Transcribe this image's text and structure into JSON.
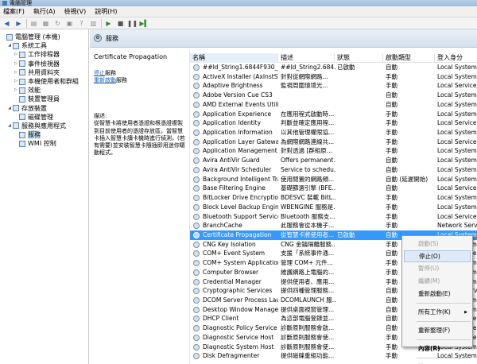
{
  "window": {
    "title": "電腦管理"
  },
  "menu": [
    "檔案(F)",
    "執行(A)",
    "檢視(V)",
    "說明(H)"
  ],
  "tree": [
    {
      "label": "電腦管理 (本機)",
      "indent": 0,
      "arrow": "",
      "icon": "computer-icon"
    },
    {
      "label": "系統工具",
      "indent": 1,
      "arrow": "◢",
      "icon": "tools-icon"
    },
    {
      "label": "工作排程器",
      "indent": 2,
      "arrow": "▷",
      "icon": "clock-icon"
    },
    {
      "label": "事件檢視器",
      "indent": 2,
      "arrow": "▷",
      "icon": "event-icon"
    },
    {
      "label": "共用資料夾",
      "indent": 2,
      "arrow": "▷",
      "icon": "folder-icon"
    },
    {
      "label": "本機使用者和群組",
      "indent": 2,
      "arrow": "▷",
      "icon": "users-icon"
    },
    {
      "label": "效能",
      "indent": 2,
      "arrow": "▷",
      "icon": "performance-icon"
    },
    {
      "label": "裝置管理員",
      "indent": 2,
      "arrow": "",
      "icon": "device-icon"
    },
    {
      "label": "存放裝置",
      "indent": 1,
      "arrow": "◢",
      "icon": "storage-icon"
    },
    {
      "label": "磁碟管理",
      "indent": 2,
      "arrow": "",
      "icon": "disk-icon"
    },
    {
      "label": "服務與應用程式",
      "indent": 1,
      "arrow": "◢",
      "icon": "apps-icon"
    },
    {
      "label": "服務",
      "indent": 2,
      "arrow": "",
      "icon": "gear-icon",
      "selected": true
    },
    {
      "label": "WMI 控制",
      "indent": 2,
      "arrow": "",
      "icon": "wmi-icon"
    }
  ],
  "header": {
    "title": "服務"
  },
  "detail": {
    "title": "Certificate Propagation",
    "stop_link": "停止",
    "stop_suffix": "服務",
    "restart_link": "重新啟動",
    "restart_suffix": "服務",
    "desc_label": "描述:",
    "desc": "從智慧卡將使用者憑證和根憑證複製到目前使用者的憑證存放區，當智慧卡插入智慧卡讀卡機時進行偵測，(若有需要)並安裝智慧卡隨插即用迷你驅動程式。"
  },
  "columns": [
    "名稱",
    "描述",
    "狀態",
    "啟動類型",
    "登入身分"
  ],
  "rows": [
    [
      "##Id_String1.6844F930_16...",
      "##Id_String2.684...",
      "已啟動",
      "自動",
      "Local System"
    ],
    [
      "ActiveX Installer (AxInstSV)",
      "針對從網際網路...",
      "",
      "手動",
      "Local System"
    ],
    [
      "Adaptive Brightness",
      "監視周圍環境光...",
      "",
      "手動",
      "Local Service"
    ],
    [
      "Adobe Version Cue CS3",
      "",
      "",
      "自動",
      "Local System"
    ],
    [
      "AMD External Events Utility",
      "",
      "",
      "自動",
      "Local System"
    ],
    [
      "Application Experience",
      "在應用程式啟動時...",
      "",
      "手動",
      "Local System"
    ],
    [
      "Application Identity",
      "判斷並確定應用程...",
      "",
      "手動",
      "Local Service"
    ],
    [
      "Application Information",
      "以其他管理權限協...",
      "",
      "手動",
      "Local System"
    ],
    [
      "Application Layer Gateway ...",
      "為網際網路連線共...",
      "",
      "手動",
      "Local Service"
    ],
    [
      "Application Management",
      "針對透過 [群組原...",
      "",
      "手動",
      "Local System"
    ],
    [
      "Avira AntiVir Guard",
      "Offers permanent...",
      "",
      "自動",
      "Local System"
    ],
    [
      "Avira AntiVir Scheduler",
      "Service to schedu...",
      "",
      "自動",
      "Local System"
    ],
    [
      "Background Intelligent Tra...",
      "使用閒置的網路頻...",
      "",
      "自動 (延遲開始)",
      "Local System"
    ],
    [
      "Base Filtering Engine",
      "基礎篩選引擎 (BFE...",
      "",
      "自動",
      "Local Service"
    ],
    [
      "BitLocker Drive Encryption ...",
      "BDESVC 裝載 BitL...",
      "",
      "手動",
      "Local System"
    ],
    [
      "Block Level Backup Engine ...",
      "WBENGINE 服務是...",
      "",
      "手動",
      "Local System"
    ],
    [
      "Bluetooth Support Service",
      "Bluetooth 服務支...",
      "",
      "手動",
      "Local Service"
    ],
    [
      "BranchCache",
      "此服務會從本機子...",
      "",
      "手動",
      "Network Service"
    ],
    [
      "Certificate Propagation",
      "從智慧卡將使用者...",
      "已啟動",
      "自動",
      "Local System"
    ],
    [
      "CNG Key Isolation",
      "CNG 金鑰隔離服務...",
      "",
      "手動",
      "Local System"
    ],
    [
      "COM+ Event System",
      "支援「系統事件通...",
      "",
      "自動",
      "Local Service"
    ],
    [
      "COM+ System Application",
      "管理 COM+ 元件...",
      "",
      "手動",
      "Local System"
    ],
    [
      "Computer Browser",
      "維護網路上電腦的...",
      "",
      "手動",
      "Local System"
    ],
    [
      "Credential Manager",
      "提供使用者、應用...",
      "",
      "手動",
      "Local System"
    ],
    [
      "Cryptographic Services",
      "提供四種管理服務...",
      "",
      "自動",
      "Network Service"
    ],
    [
      "DCOM Server Process Laun...",
      "DCOMLAUNCH 服...",
      "",
      "自動",
      "Local System"
    ],
    [
      "Desktop Window Manager ...",
      "提供桌面視窗管理...",
      "",
      "自動",
      "Local System"
    ],
    [
      "DHCP Client",
      "為這部電腦登錄並...",
      "",
      "自動",
      "Local Service"
    ],
    [
      "Diagnostic Policy Service",
      "診斷原則服務會啟...",
      "",
      "自動",
      "Local Service"
    ],
    [
      "Diagnostic Service Host",
      "診斷原則服務會使...",
      "",
      "手動",
      "Local Service"
    ],
    [
      "Diagnostic System Host",
      "診斷原則服務會使...",
      "",
      "手動",
      "Local System"
    ],
    [
      "Disk Defragmenter",
      "提供磁碟重組功能...",
      "",
      "手動",
      "Local System"
    ]
  ],
  "context_menu": [
    {
      "label": "啟動(S)",
      "disabled": true
    },
    {
      "label": "停止(O)",
      "highlight": true
    },
    {
      "label": "暫停(U)",
      "disabled": true
    },
    {
      "label": "繼續(M)",
      "disabled": true
    },
    {
      "label": "重新啟動(E)"
    },
    {
      "sep": true
    },
    {
      "label": "所有工作(K)",
      "sub": true
    },
    {
      "sep": true
    },
    {
      "label": "重新整理(F)"
    },
    {
      "sep": true
    },
    {
      "label": "內容(R)",
      "bold": true
    },
    {
      "sep": true
    },
    {
      "label": "說明(H)"
    }
  ]
}
